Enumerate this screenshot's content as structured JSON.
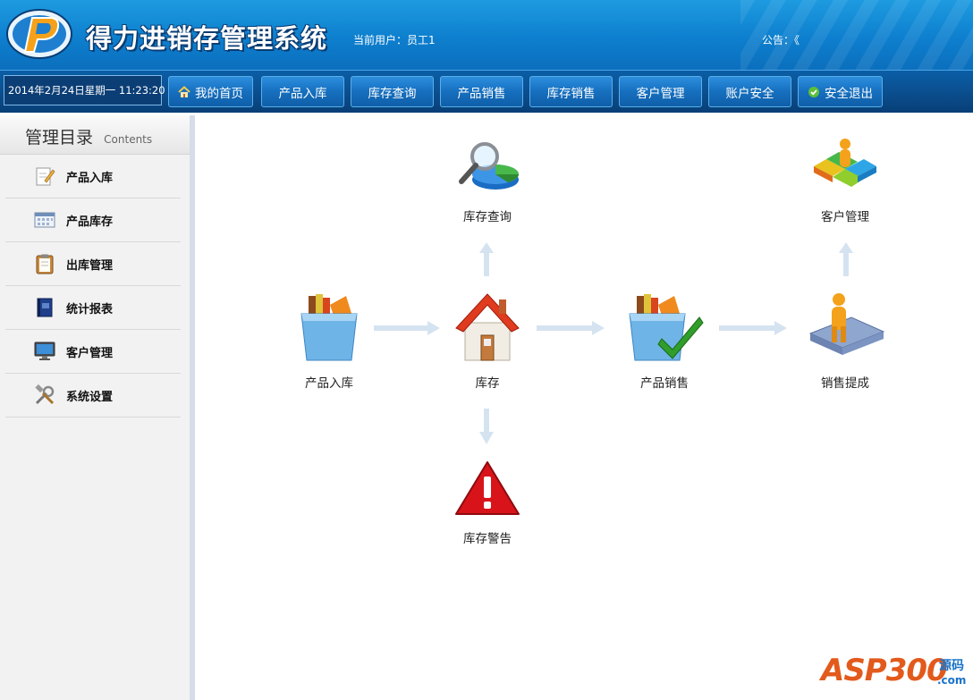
{
  "header": {
    "app_title": "得力进销存管理系统",
    "current_user": "当前用户：员工1",
    "notice": "公告：《"
  },
  "navbar": {
    "datetime": "2014年2月24日星期一 11:23:20",
    "items": [
      {
        "label": "我的首页",
        "icon": "home-icon"
      },
      {
        "label": "产品入库"
      },
      {
        "label": "库存查询"
      },
      {
        "label": "产品销售"
      },
      {
        "label": "库存销售"
      },
      {
        "label": "客户管理"
      },
      {
        "label": "账户安全"
      },
      {
        "label": "安全退出",
        "icon": "check-circle-icon"
      }
    ]
  },
  "sidebar": {
    "title": "管理目录",
    "subtitle": "Contents",
    "items": [
      {
        "label": "产品入库",
        "icon": "pencil-note-icon"
      },
      {
        "label": "产品库存",
        "icon": "calendar-grid-icon"
      },
      {
        "label": "出库管理",
        "icon": "clipboard-icon"
      },
      {
        "label": "统计报表",
        "icon": "book-icon"
      },
      {
        "label": "客户管理",
        "icon": "monitor-icon"
      },
      {
        "label": "系统设置",
        "icon": "tools-icon"
      }
    ]
  },
  "flow": {
    "inventory_query": "库存查询",
    "customer_management": "客户管理",
    "product_stock_in": "产品入库",
    "inventory": "库存",
    "product_sales": "产品销售",
    "sales_commission": "销售提成",
    "inventory_warning": "库存警告"
  },
  "watermark": {
    "text": "ASP300",
    "cn": "源码",
    "com": ".com"
  },
  "colors": {
    "header_blue": "#0d7fce",
    "nav_blue": "#0b4f8f",
    "arrow": "#c9d9ea"
  }
}
